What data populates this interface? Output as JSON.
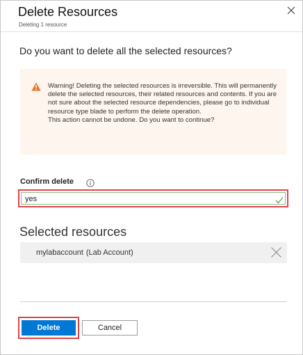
{
  "header": {
    "title": "Delete Resources",
    "subtitle": "Deleting 1 resource",
    "close_icon": "close-icon"
  },
  "question": "Do you want to delete all the selected resources?",
  "warning": {
    "icon": "warning-icon",
    "accent_color": "#e8772e",
    "background": "#fdf5ee",
    "text_main": "Warning! Deleting the selected resources is irreversible. This will permanently delete the selected resources, their related resources and contents. If you are not sure about the selected resource dependencies, please go to individual resource type blade to perform the delete operation.",
    "text_confirm": "This action cannot be undone. Do you want to continue?"
  },
  "confirm": {
    "label": "Confirm delete",
    "info_icon": "info-icon",
    "value": "yes",
    "valid": true,
    "valid_icon": "checkmark-icon",
    "valid_color": "#5fa85f"
  },
  "selected_resources": {
    "title": "Selected resources",
    "items": [
      {
        "name": "mylabaccount",
        "type": "(Lab Account)",
        "remove_icon": "remove-icon"
      }
    ]
  },
  "buttons": {
    "delete_label": "Delete",
    "cancel_label": "Cancel",
    "primary_color": "#0078d4"
  },
  "highlight_color": "#e0434a"
}
